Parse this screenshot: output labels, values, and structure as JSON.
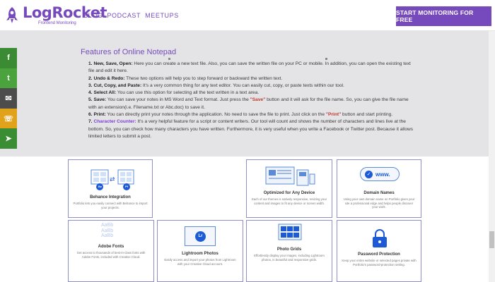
{
  "header": {
    "logo_name": "LogRocket",
    "logo_sub": "Frontend Monitoring",
    "nav": [
      "BLOG",
      "PODCAST",
      "MEETUPS"
    ],
    "cta": "START MONITORING FOR FREE"
  },
  "colors": {
    "brand": "#764abc",
    "band": "#e4e4e6",
    "card_border": "#8f8fc8"
  },
  "features": {
    "heading": "Features of Online Notepad",
    "items": [
      {
        "num": "1.",
        "label": "New, Save, Open:",
        "text": " Here you can create a new text file. Also, you can save the written file on your PC or mobile. In addition, you can open the existing text file and edit it here."
      },
      {
        "num": "2.",
        "label": "Undo & Redo:",
        "text": " These two options will help you to step forward or backward the written text."
      },
      {
        "num": "3.",
        "label": "Cut, Copy, and Paste:",
        "text": " It's a very common thing for any text editor. You can easily cut, copy, or paste texts within our tool."
      },
      {
        "num": "4.",
        "label": "Select All:",
        "text": " You can use this option for selecting all the text written in a text area."
      },
      {
        "num": "5.",
        "label": "Save:",
        "text_a": " You can save your notes in MS Word and Text format. Just press the ",
        "accent": "\"Save\"",
        "text_b": " button and it will ask for the file name. So, you can give the file name with an extension(i.e. Filename.txt or Abc.doc) to save it."
      },
      {
        "num": "6.",
        "label": "Print:",
        "text_a": " You can directly print your notes through the application. No need to save the file to print. Just click on the ",
        "accent": "\"Print\"",
        "text_b": " button and start printing."
      },
      {
        "num": "7.",
        "label": "Character Counter:",
        "text": " It's a very helpful feature for a script or content writers. Our tool will count and shows the number of characters and lines live at the bottom. So, you can check how many characters you have written. Furthermore, it is very useful when you write a Facebook or Twitter post. Because it allows limited letters to submit a post."
      }
    ]
  },
  "share": [
    {
      "icon": "facebook-icon",
      "glyph": "f"
    },
    {
      "icon": "twitter-icon",
      "glyph": "t"
    },
    {
      "icon": "email-icon",
      "glyph": "✉"
    },
    {
      "icon": "whatsapp-icon",
      "glyph": "☏"
    },
    {
      "icon": "telegram-icon",
      "glyph": "➤"
    }
  ],
  "cards": [
    {
      "title": "Behance Integration",
      "desc": "Portfolio lets you easily connect with Behance to import your projects.",
      "badges": [
        "Be",
        "Pf"
      ]
    },
    {
      "title": "Optimized for Any Device",
      "desc": "Each of our themes is natively responsive, resizing your content and images to fit any device or screen width."
    },
    {
      "title": "Domain Names",
      "desc": "Using your own domain name on Portfolio gives your site a professional edge and helps people discover your work.",
      "domain": "www."
    },
    {
      "title": "Adobe Fonts",
      "desc": "Get access to thousands of best-in-class fonts with Adobe Fonts, included with Creative Cloud.",
      "sample": [
        "AaBb",
        "AaBb",
        "AaBb"
      ]
    },
    {
      "title": "Lightroom Photos",
      "desc": "Easily access and import your photos from Lightroom with your Creative Cloud account.",
      "badge": "Lr"
    },
    {
      "title": "Photo Grids",
      "desc": "Effortlessly display your images, including Lightroom photos, in beautiful and responsive grids."
    },
    {
      "title": "Password Protection",
      "desc": "Keep your entire website or selected pages private with Portfolio's password-protection setting."
    }
  ]
}
